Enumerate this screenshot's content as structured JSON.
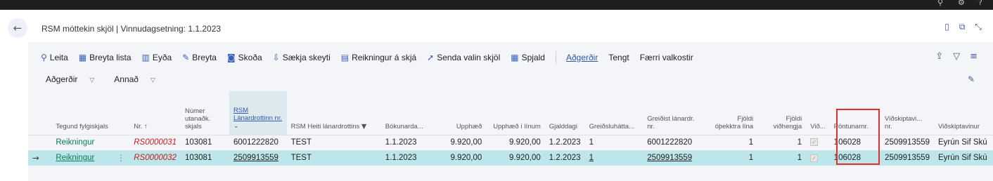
{
  "window": {
    "title": "RSM móttekin skjöl | Vinnudagsetning: 1.1.2023",
    "top_icons": [
      "search-icon",
      "settings-icon",
      "help-icon"
    ],
    "right_icons": [
      "bookmark-icon",
      "open-new-window-icon",
      "collapse-icon"
    ]
  },
  "actions": [
    {
      "label": "Leita",
      "icon": "search-icon",
      "glyph": "⚲"
    },
    {
      "label": "Breyta lista",
      "icon": "edit-list-icon",
      "glyph": "▦"
    },
    {
      "label": "Eyða",
      "icon": "delete-icon",
      "glyph": "🗑"
    },
    {
      "label": "Breyta",
      "icon": "pencil-icon",
      "glyph": "✎"
    },
    {
      "label": "Skoða",
      "icon": "view-icon",
      "glyph": "◙"
    },
    {
      "label": "Sækja skeyti",
      "icon": "fetch-icon",
      "glyph": "⇩"
    },
    {
      "label": "Reikningur á skjá",
      "icon": "invoice-icon",
      "glyph": "▤"
    },
    {
      "label": "Senda valin skjöl",
      "icon": "send-icon",
      "glyph": "➚"
    },
    {
      "label": "Spjald",
      "icon": "card-icon",
      "glyph": "▦"
    },
    {
      "label": "Aðgerðir",
      "selected": true
    },
    {
      "label": "Tengt"
    },
    {
      "label": "Færri valkostir"
    }
  ],
  "subbar": {
    "item1": "Aðgerðir",
    "item2": "Annað"
  },
  "columns": [
    {
      "key": "tegund",
      "label": "Tegund fylgiskjals"
    },
    {
      "key": "nr",
      "label": "Nr. ↑"
    },
    {
      "key": "numer",
      "label": "Númer utanaðk. skjals"
    },
    {
      "key": "rsm",
      "label": "RSM Lánardrottinn nr."
    },
    {
      "key": "heiti",
      "label": "RSM Heiti lánardrottins"
    },
    {
      "key": "bokun",
      "label": "Bókunarda..."
    },
    {
      "key": "upphaed",
      "label": "Upphæð"
    },
    {
      "key": "upphaed_linum",
      "label": "Upphæð í línum"
    },
    {
      "key": "gjalddagi",
      "label": "Gjalddagi"
    },
    {
      "key": "greidslu",
      "label": "Greiðsluhátta..."
    },
    {
      "key": "greidist",
      "label": "Greiðist lánardr. nr."
    },
    {
      "key": "fjoldi_lina",
      "label": "Fjöldi óþekktra lína"
    },
    {
      "key": "fjoldi_vid",
      "label": "Fjöldi viðhengja"
    },
    {
      "key": "vid",
      "label": "Við..."
    },
    {
      "key": "pontun",
      "label": "Pöntunarnr."
    },
    {
      "key": "vidskiptavinr",
      "label": "Viðskiptavi... nr."
    },
    {
      "key": "vidskiptavinur",
      "label": "Viðskiptavinur"
    }
  ],
  "rows": [
    {
      "tegund": "Reikningur",
      "nr": "RS0000031",
      "numer": "103081",
      "rsm": "6001222820",
      "heiti": "TEST",
      "bokun": "1.1.2023",
      "upphaed": "9.920,00",
      "upphaed_linum": "9.920,00",
      "gjalddagi": "1.2.2023",
      "greidslu": "1",
      "greidist": "6001222820",
      "fjoldi_lina": "1",
      "fjoldi_vid": "1",
      "vid": false,
      "pontun": "106028",
      "vidskiptavinr": "2509913559",
      "vidskiptavinur": "Eyrún Sif Skú"
    },
    {
      "tegund": "Reikningur",
      "nr": "RS0000032",
      "numer": "103081",
      "rsm": "2509913559",
      "heiti": "TEST",
      "bokun": "1.1.2023",
      "upphaed": "9.920,00",
      "upphaed_linum": "9.920,00",
      "gjalddagi": "1.2.2023",
      "greidslu": "1",
      "greidist": "2509913559",
      "fjoldi_lina": "1",
      "fjoldi_vid": "1",
      "vid": false,
      "pontun": "106028",
      "vidskiptavinr": "2509913559",
      "vidskiptavinur": "Eyrún Sif Skú",
      "selected": true
    }
  ]
}
